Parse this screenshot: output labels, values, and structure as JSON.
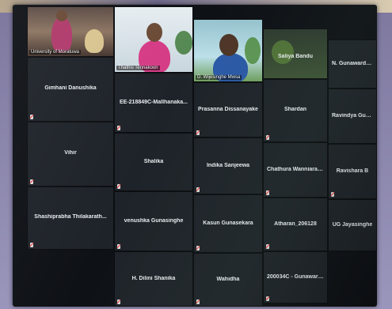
{
  "meeting": {
    "participants": [
      {
        "id": "p1",
        "label": "University of Moratuwa",
        "video": true
      },
      {
        "id": "p2",
        "label": "Thathsi Tennakoon",
        "video": true
      },
      {
        "id": "p3",
        "label": "D. Wijesinghe Mwsa",
        "video": true
      },
      {
        "id": "p4",
        "label": "Saliya Bandu",
        "video": true
      },
      {
        "id": "p5",
        "label": "N. Gunawardhana",
        "video": false
      },
      {
        "id": "p6",
        "label": "Gimhani Danushika",
        "video": false
      },
      {
        "id": "p7",
        "label": "EE-218849C-Mallhanaka...",
        "video": false
      },
      {
        "id": "p8",
        "label": "Prasanna Dissanayake",
        "video": false
      },
      {
        "id": "p9",
        "label": "Shardan",
        "video": false
      },
      {
        "id": "p10",
        "label": "Ravindya Gunasinghe",
        "video": false
      },
      {
        "id": "p11",
        "label": "Vihir",
        "video": false
      },
      {
        "id": "p12",
        "label": "Shalika",
        "video": false
      },
      {
        "id": "p13",
        "label": "Indika Sanjeewa",
        "video": false
      },
      {
        "id": "p14",
        "label": "Chathura Wanniarachchi",
        "video": false
      },
      {
        "id": "p15",
        "label": "Ravishara B",
        "video": false
      },
      {
        "id": "p16",
        "label": "Shashiprabha Thilakarath...",
        "video": false
      },
      {
        "id": "p17",
        "label": "venushka Gunasinghe",
        "video": false
      },
      {
        "id": "p18",
        "label": "Kasun Gunasekara",
        "video": false
      },
      {
        "id": "p19",
        "label": "Atharan_206128",
        "video": false
      },
      {
        "id": "p20",
        "label": "UG Jayasinghe",
        "video": false
      },
      {
        "id": "p21",
        "label": "H. Dilini Shanika",
        "video": false
      },
      {
        "id": "p22",
        "label": "Wahidha",
        "video": false
      },
      {
        "id": "p23",
        "label": "200034C - Gunawardhan...",
        "video": false
      }
    ]
  },
  "colors": {
    "tile_bg": "#1e2329",
    "screen_bg": "#0e1116",
    "name_text": "#e8ecef",
    "muted_slash": "#e33"
  },
  "icons": {
    "muted": "microphone-muted-icon"
  }
}
